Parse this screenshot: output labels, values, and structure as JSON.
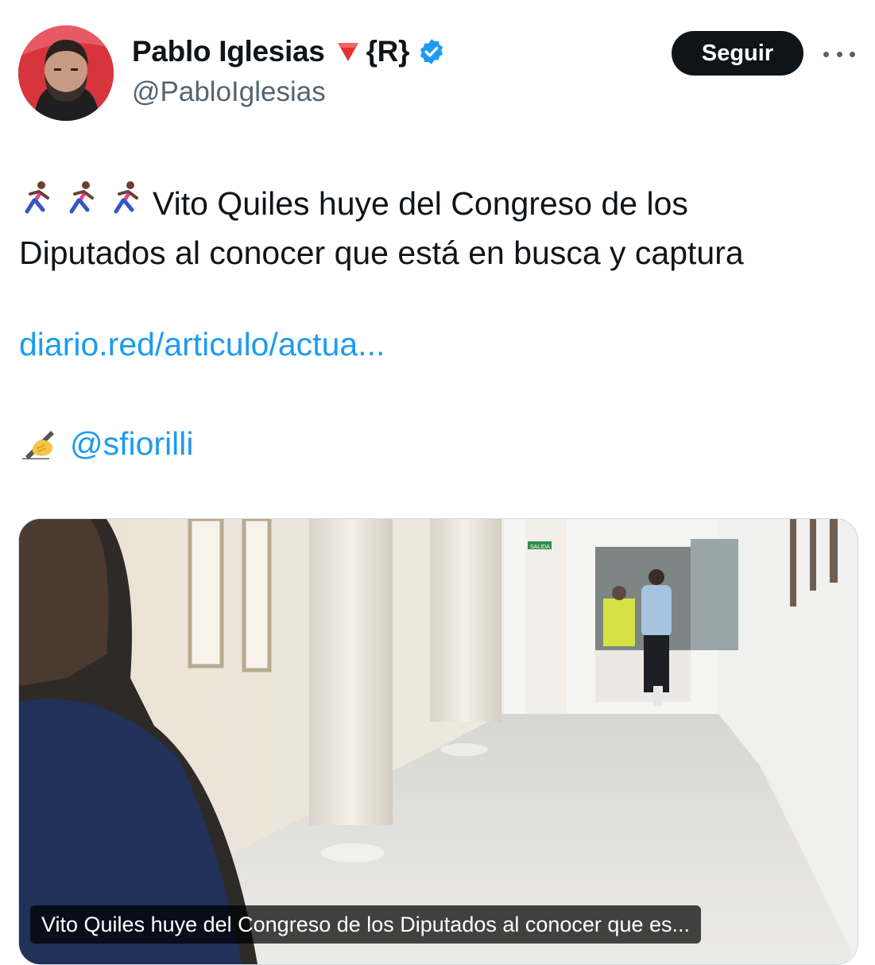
{
  "author": {
    "display_name": "Pablo Iglesias",
    "flair": "{R}",
    "handle": "@PabloIglesias",
    "verified": true
  },
  "actions": {
    "follow_label": "Seguir",
    "more_icon": "more-horizontal-icon"
  },
  "tweet": {
    "line1": "Vito Quiles huye del Congreso de los",
    "line2": "Diputados al conocer que está en busca y captura",
    "link": "diario.red/articulo/actua...",
    "mention": "@sfiorilli"
  },
  "media": {
    "caption": "Vito Quiles huye del Congreso de los Diputados al conocer que es...",
    "sign_text": "SALIDA"
  },
  "colors": {
    "link": "#1d9bf0",
    "verified": "#1d9bf0",
    "follow_bg": "#0f1419",
    "handle": "#536471"
  }
}
